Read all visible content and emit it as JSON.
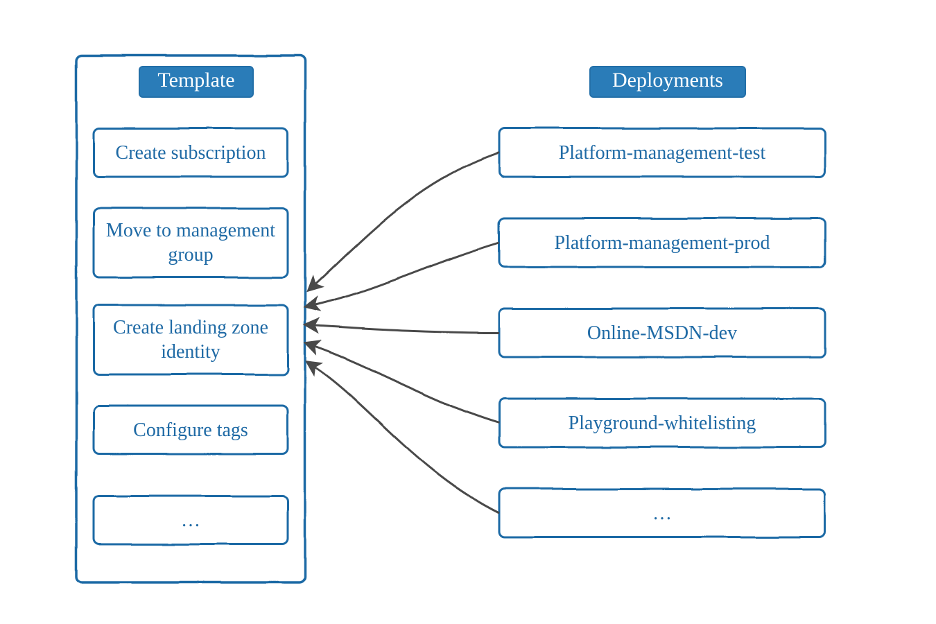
{
  "left": {
    "title": "Template",
    "items": [
      "Create subscription",
      "Move to management group",
      "Create landing zone identity",
      "Configure tags",
      "…"
    ]
  },
  "right": {
    "title": "Deployments",
    "items": [
      "Platform-management-test",
      "Platform-management-prod",
      "Online-MSDN-dev",
      "Playground-whitelisting",
      "…"
    ]
  },
  "colors": {
    "stroke": "#1f6aa5",
    "title_bg": "#2a7cb8",
    "arrow": "#4a4a4a"
  }
}
